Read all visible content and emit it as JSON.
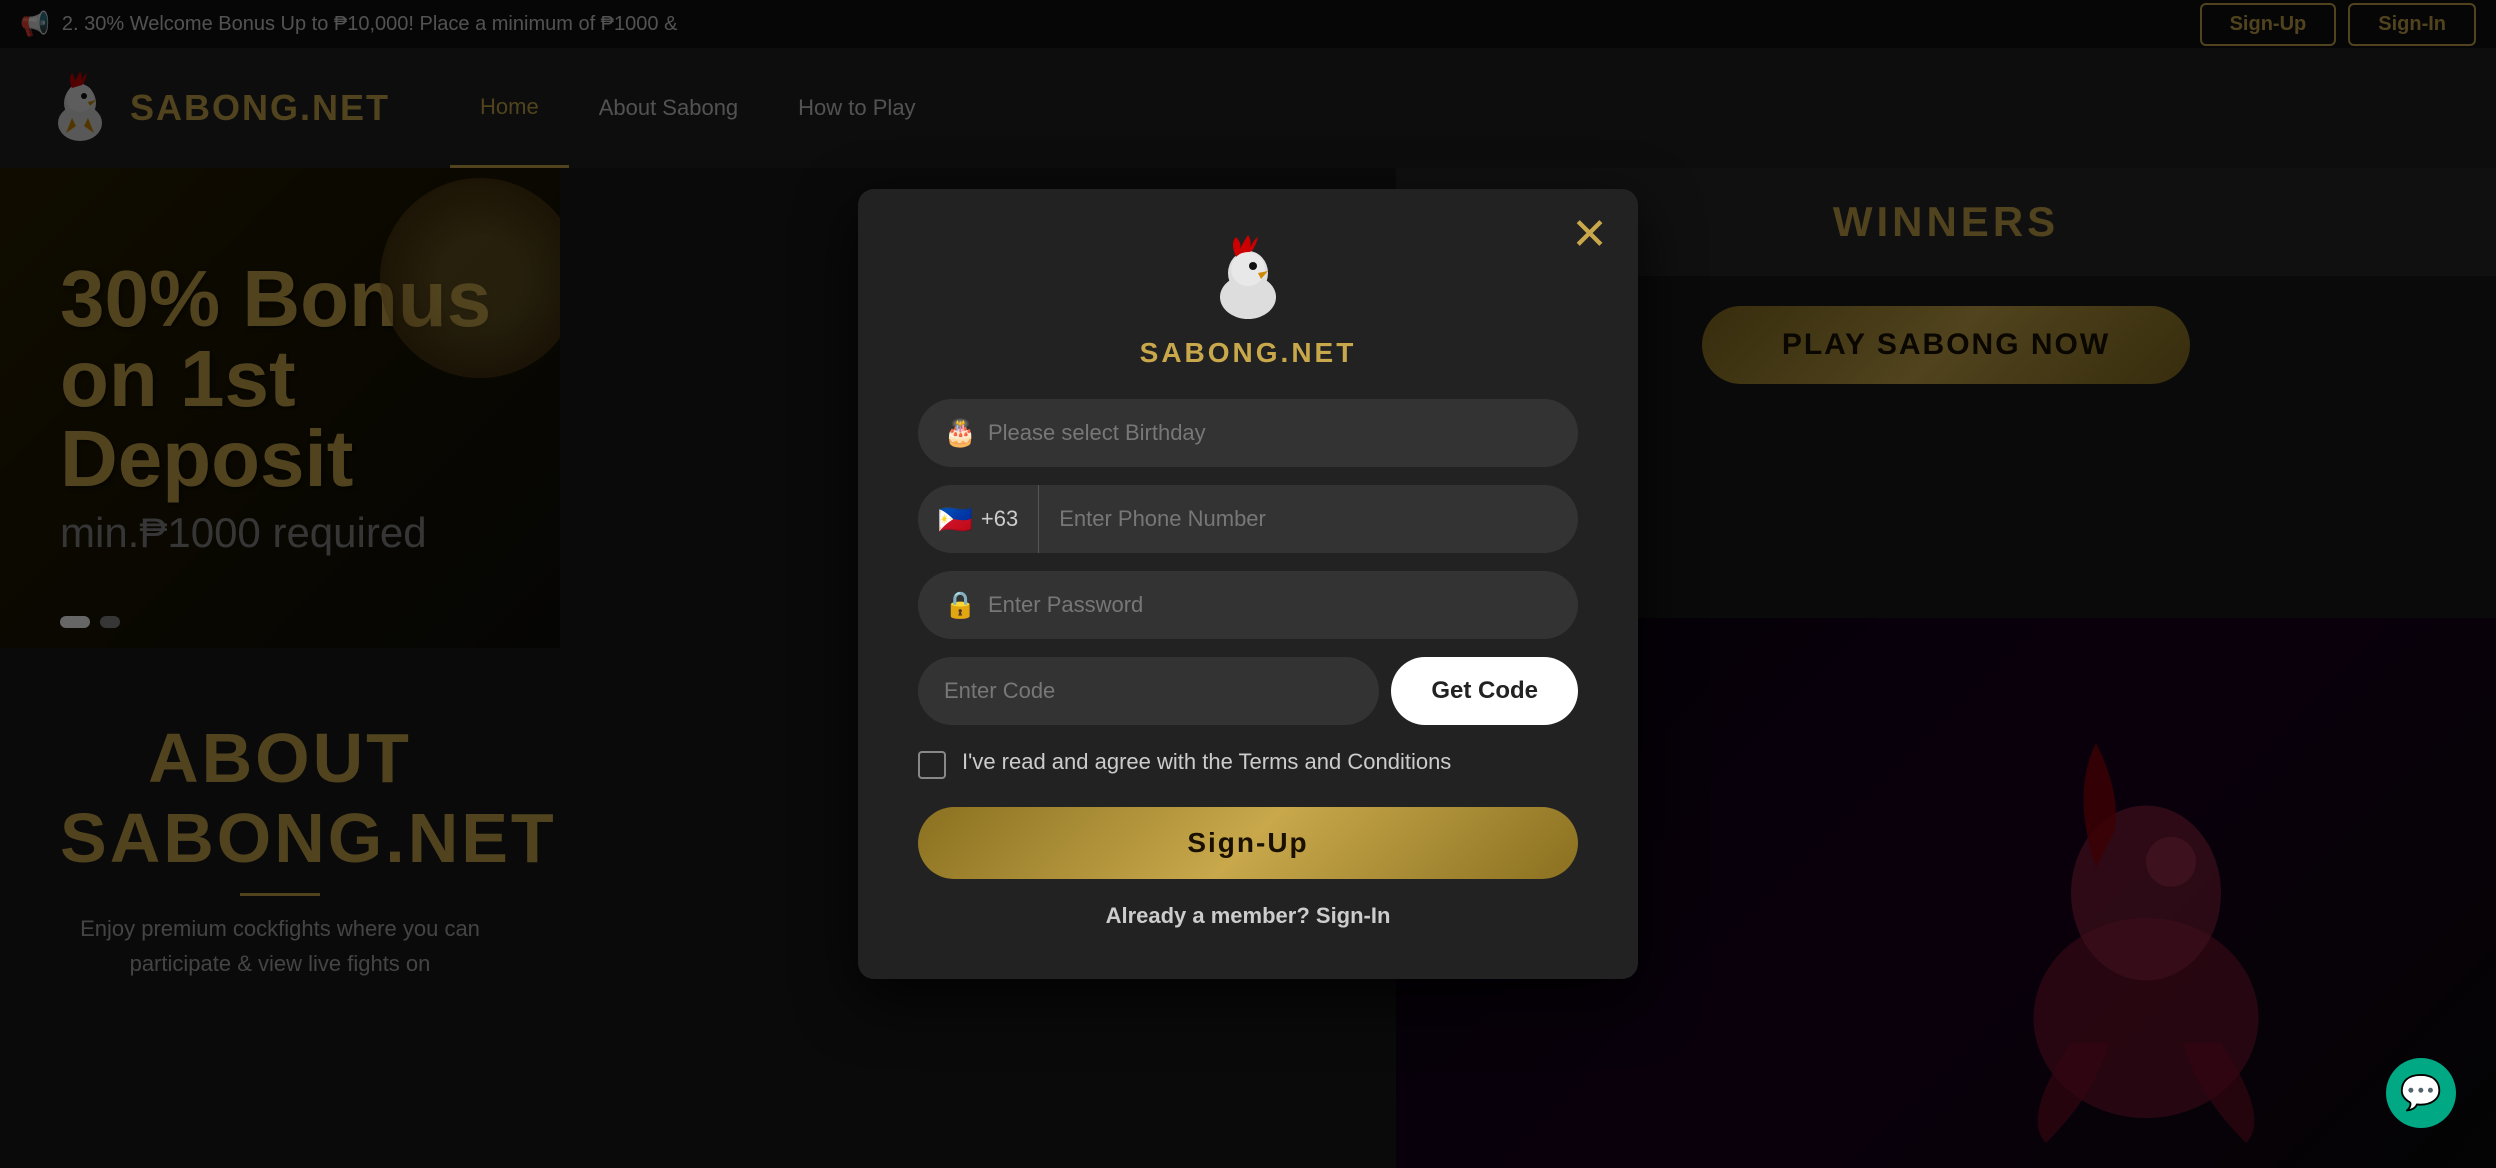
{
  "announcement": {
    "icon": "📢",
    "text": "2. 30% Welcome Bonus Up to ₱10,000! Place a minimum of ₱1000 &",
    "signUpLabel": "Sign-Up",
    "signInLabel": "Sign-In"
  },
  "header": {
    "logoText": "SABONG.NET",
    "navLinks": [
      {
        "label": "Home",
        "active": true
      },
      {
        "label": "About Sabong",
        "active": false
      },
      {
        "label": "How to Play",
        "active": false
      }
    ]
  },
  "hero": {
    "bonusTitle": "30% Bonus",
    "bonusLine2": "on 1st Deposit",
    "bonusLine3": "min.₱1000 required"
  },
  "about": {
    "title": "ABOUT\nSABONG.NET",
    "text": "Enjoy premium cockfights where you\ncan participate & view live fights on"
  },
  "winners": {
    "title": "WINNERS",
    "playButton": "PLAY SABONG NOW"
  },
  "modal": {
    "logoText": "SABONG.NET",
    "closeIcon": "✕",
    "birthdayPlaceholder": "Please select Birthday",
    "birthdayIcon": "🎂",
    "phonePrefix": "+63",
    "phoneFlag": "🇵🇭",
    "phonePlaceholder": "Enter Phone Number",
    "passwordPlaceholder": "Enter Password",
    "passwordIcon": "🔒",
    "codePlaceholder": "Enter Code",
    "getCodeLabel": "Get Code",
    "termsText": "I've read and agree with the Terms and Conditions",
    "signUpLabel": "Sign-Up",
    "alreadyMember": "Already a member?",
    "signInLabel": "Sign-In"
  },
  "chat": {
    "icon": "💬"
  }
}
